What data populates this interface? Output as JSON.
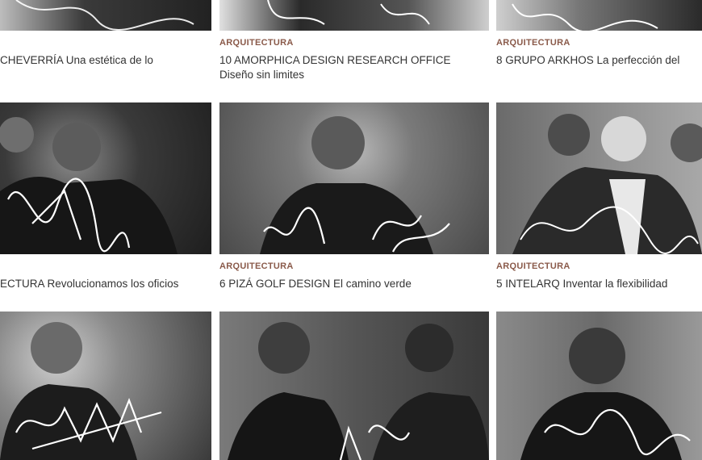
{
  "articles": [
    {
      "category": "",
      "title": "CHEVERRÍA Una estética de lo"
    },
    {
      "category": "ARQUITECTURA",
      "title": "10 AMORPHICA DESIGN RESEARCH OFFICE Diseño sin limites"
    },
    {
      "category": "ARQUITECTURA",
      "title": "8 GRUPO ARKHOS La perfección del"
    },
    {
      "category": "",
      "title": "ECTURA Revolucionamos los oficios"
    },
    {
      "category": "ARQUITECTURA",
      "title": "6 PIZÁ GOLF DESIGN El camino verde"
    },
    {
      "category": "ARQUITECTURA",
      "title": "5 INTELARQ Inventar la flexibilidad"
    }
  ],
  "colors": {
    "category": "#8a5a4a",
    "title": "#333333",
    "photo_dark": "#2a2a2a"
  }
}
